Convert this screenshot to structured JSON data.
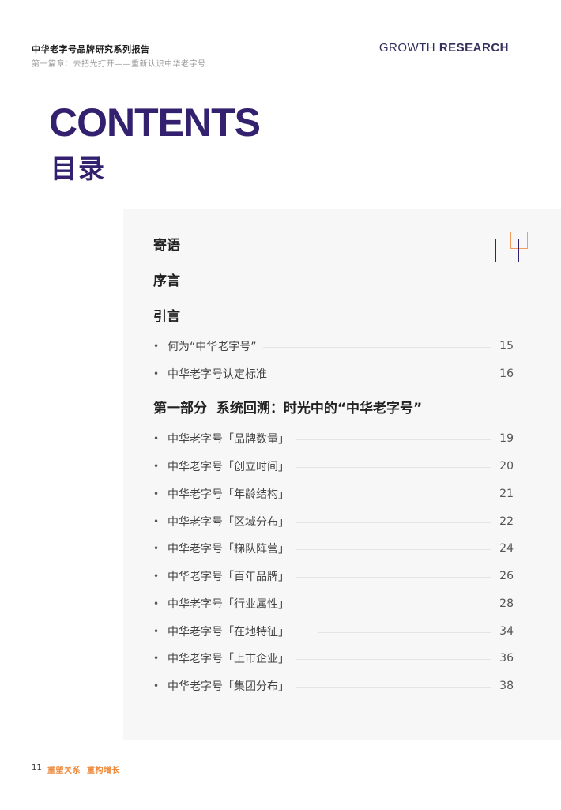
{
  "header": {
    "title": "中华老字号品牌研究系列报告",
    "subtitle": "第一篇章：去把光打开——重新认识中华老字号",
    "brand_part1": "GROWTH ",
    "brand_part2": "RESEARCH"
  },
  "title_en": "CONTENTS",
  "title_cn": "目录",
  "toc": {
    "h1": "寄语",
    "h2": "序言",
    "h3": "引言",
    "intro_items": [
      {
        "label": "何为“中华老字号”",
        "page": "15"
      },
      {
        "label": "中华老字号认定标准",
        "page": "16"
      }
    ],
    "part1": "第一部分  系统回溯：时光中的“中华老字号”",
    "part1_items": [
      {
        "label": "中华老字号「品牌数量」",
        "page": "19"
      },
      {
        "label": "中华老字号「创立时间」",
        "page": "20"
      },
      {
        "label": "中华老字号「年龄结构」",
        "page": "21"
      },
      {
        "label": "中华老字号「区域分布」",
        "page": "22"
      },
      {
        "label": "中华老字号「梯队阵营」",
        "page": "24"
      },
      {
        "label": "中华老字号「百年品牌」",
        "page": "26"
      },
      {
        "label": "中华老字号「行业属性」",
        "page": "28"
      },
      {
        "label": "中华老字号「在地特征」",
        "page": "34"
      },
      {
        "label": "中华老字号「上市企业」",
        "page": "36"
      },
      {
        "label": "中华老字号「集团分布」",
        "page": "38"
      }
    ]
  },
  "footer": {
    "page_number": "11",
    "slogan": "重塑关系  重构增长"
  },
  "colors": {
    "primary_purple": "#33216f",
    "accent_orange": "#ee8a3c"
  }
}
